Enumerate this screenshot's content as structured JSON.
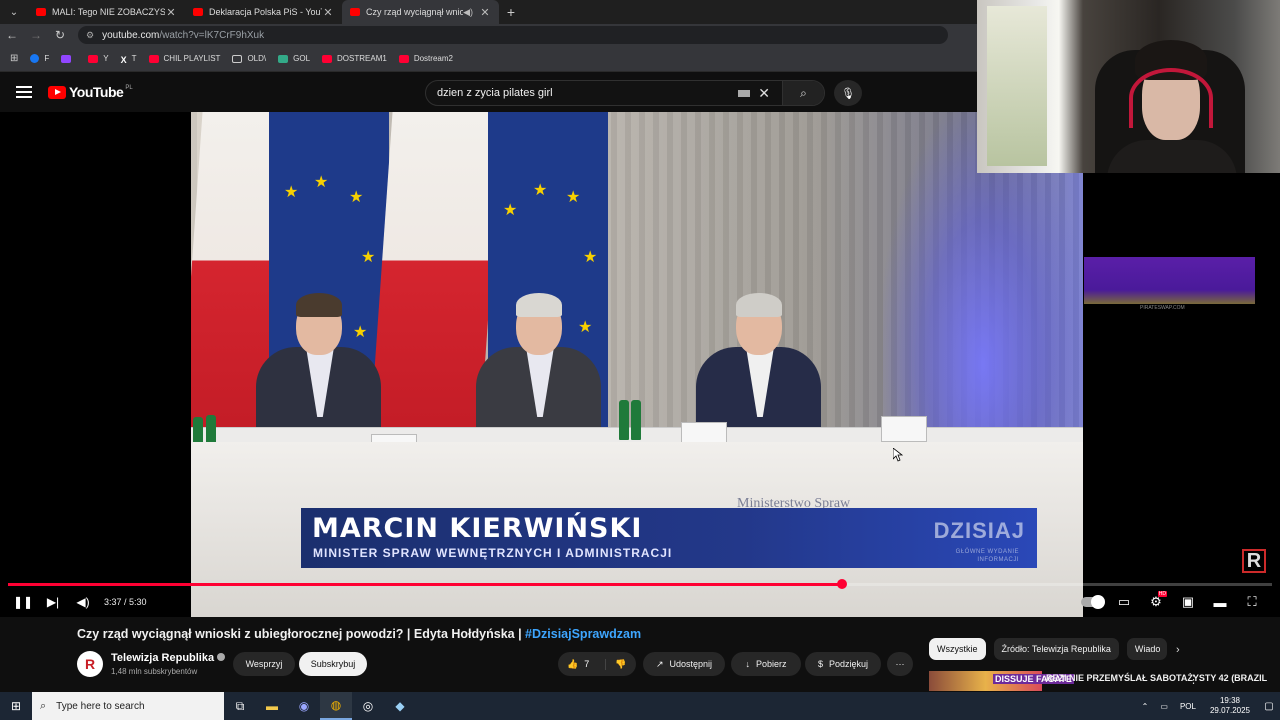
{
  "browser": {
    "tabs": [
      {
        "title": "MALI: Tego NIE ZOBACZYSZ w",
        "active": false
      },
      {
        "title": "Deklaracja Polska PiS - YouTube",
        "active": false
      },
      {
        "title": "Czy rząd wyciągnął wniosk",
        "active": true
      }
    ],
    "url_host": "youtube.com",
    "url_path": "/watch?v=lK7CrF9hXuk",
    "bookmarks": [
      "F",
      "Y",
      "T",
      "CHIL PLAYLIST",
      "OLD\\",
      "GOL",
      "DOSTREAM1",
      "Dostream2"
    ]
  },
  "youtube": {
    "logo_text": "YouTube",
    "logo_region": "PL",
    "search_query": "dzien z zycia pilates girl"
  },
  "video": {
    "lower_third_name": "MARCIN KIERWIŃSKI",
    "lower_third_role": "MINISTER SPRAW WEWNĘTRZNYCH I ADMINISTRACJI",
    "show_name": "DZISIAJ",
    "show_sub_line1": "GŁÓWNE WYDANIE",
    "show_sub_line2": "INFORMACJI",
    "ministry_text": "Ministerstwo Spraw",
    "channel_logo_letter": "R",
    "side_ad_label": "PIRATESWAP.COM",
    "time_current": "3:37",
    "time_total": "5:30",
    "progress_fraction": 0.66,
    "accent_color": "#ff0033"
  },
  "details": {
    "title_main": "Czy rząd wyciągnął wnioski z ubiegłorocznej powodzi? | Edyta Hołdyńska | ",
    "title_hashtag": "#DzisiajSprawdzam",
    "channel_name": "Telewizja Republika",
    "channel_subs": "1,48 mln subskrybentów",
    "support_label": "Wesprzyj",
    "subscribe_label": "Subskrybuj",
    "like_count": "7",
    "share_label": "Udostępnij",
    "download_label": "Pobierz",
    "thanks_label": "Podziękuj",
    "more_label": "···"
  },
  "sidebar": {
    "chips": [
      "Wszystkie",
      "Źródło: Telewizja Republika",
      "Wiado"
    ],
    "rec_badge": "DISSUJE FAGATE",
    "rec_title": "REZI NIE PRZEMYŚLAŁ SABOTAŻYSTY 42 (BRAZIL"
  },
  "taskbar": {
    "search_placeholder": "Type here to search",
    "lang": "POL",
    "time": "19:38",
    "date": "29.07.2025"
  }
}
